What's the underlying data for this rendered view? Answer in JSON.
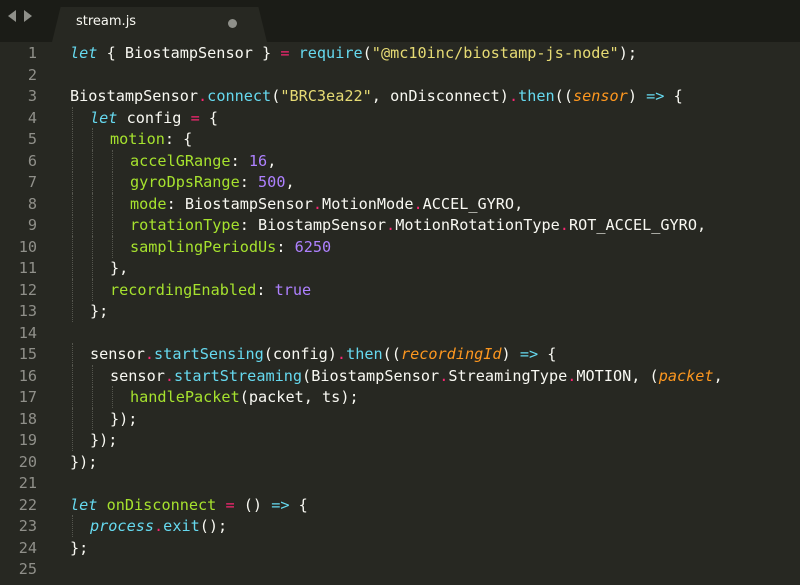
{
  "tab": {
    "label": "stream.js"
  },
  "lines": [
    {
      "n": "1",
      "indent": 0,
      "tokens": [
        [
          "kw",
          "let"
        ],
        [
          "plain",
          " { BiostampSensor } "
        ],
        [
          "op",
          "="
        ],
        [
          "plain",
          " "
        ],
        [
          "fn",
          "require"
        ],
        [
          "plain",
          "("
        ],
        [
          "str",
          "\"@mc10inc/biostamp-js-node\""
        ],
        [
          "plain",
          ");"
        ]
      ]
    },
    {
      "n": "2",
      "indent": 0,
      "tokens": []
    },
    {
      "n": "3",
      "indent": 0,
      "tokens": [
        [
          "plain",
          "BiostampSensor"
        ],
        [
          "op",
          "."
        ],
        [
          "fn",
          "connect"
        ],
        [
          "plain",
          "("
        ],
        [
          "str",
          "\"BRC3ea22\""
        ],
        [
          "plain",
          ", onDisconnect)"
        ],
        [
          "op",
          "."
        ],
        [
          "fn",
          "then"
        ],
        [
          "plain",
          "(("
        ],
        [
          "param",
          "sensor"
        ],
        [
          "plain",
          ") "
        ],
        [
          "fn",
          "=>"
        ],
        [
          "plain",
          " {"
        ]
      ]
    },
    {
      "n": "4",
      "indent": 1,
      "tokens": [
        [
          "kw",
          "let"
        ],
        [
          "plain",
          " config "
        ],
        [
          "op",
          "="
        ],
        [
          "plain",
          " {"
        ]
      ]
    },
    {
      "n": "5",
      "indent": 2,
      "tokens": [
        [
          "objkey",
          "motion"
        ],
        [
          "plain",
          ": {"
        ]
      ]
    },
    {
      "n": "6",
      "indent": 3,
      "tokens": [
        [
          "objkey",
          "accelGRange"
        ],
        [
          "plain",
          ": "
        ],
        [
          "num",
          "16"
        ],
        [
          "plain",
          ","
        ]
      ]
    },
    {
      "n": "7",
      "indent": 3,
      "tokens": [
        [
          "objkey",
          "gyroDpsRange"
        ],
        [
          "plain",
          ": "
        ],
        [
          "num",
          "500"
        ],
        [
          "plain",
          ","
        ]
      ]
    },
    {
      "n": "8",
      "indent": 3,
      "tokens": [
        [
          "objkey",
          "mode"
        ],
        [
          "plain",
          ": BiostampSensor"
        ],
        [
          "op",
          "."
        ],
        [
          "plain",
          "MotionMode"
        ],
        [
          "op",
          "."
        ],
        [
          "plain",
          "ACCEL_GYRO,"
        ]
      ]
    },
    {
      "n": "9",
      "indent": 3,
      "tokens": [
        [
          "objkey",
          "rotationType"
        ],
        [
          "plain",
          ": BiostampSensor"
        ],
        [
          "op",
          "."
        ],
        [
          "plain",
          "MotionRotationType"
        ],
        [
          "op",
          "."
        ],
        [
          "plain",
          "ROT_ACCEL_GYRO,"
        ]
      ]
    },
    {
      "n": "10",
      "indent": 3,
      "tokens": [
        [
          "objkey",
          "samplingPeriodUs"
        ],
        [
          "plain",
          ": "
        ],
        [
          "num",
          "6250"
        ]
      ]
    },
    {
      "n": "11",
      "indent": 2,
      "tokens": [
        [
          "plain",
          "},"
        ]
      ]
    },
    {
      "n": "12",
      "indent": 2,
      "tokens": [
        [
          "objkey",
          "recordingEnabled"
        ],
        [
          "plain",
          ": "
        ],
        [
          "bool",
          "true"
        ]
      ]
    },
    {
      "n": "13",
      "indent": 1,
      "tokens": [
        [
          "plain",
          "};"
        ]
      ]
    },
    {
      "n": "14",
      "indent": 0,
      "tokens": []
    },
    {
      "n": "15",
      "indent": 1,
      "tokens": [
        [
          "plain",
          "sensor"
        ],
        [
          "op",
          "."
        ],
        [
          "fn",
          "startSensing"
        ],
        [
          "plain",
          "(config)"
        ],
        [
          "op",
          "."
        ],
        [
          "fn",
          "then"
        ],
        [
          "plain",
          "(("
        ],
        [
          "param",
          "recordingId"
        ],
        [
          "plain",
          ") "
        ],
        [
          "fn",
          "=>"
        ],
        [
          "plain",
          " {"
        ]
      ]
    },
    {
      "n": "16",
      "indent": 2,
      "tokens": [
        [
          "plain",
          "sensor"
        ],
        [
          "op",
          "."
        ],
        [
          "fn",
          "startStreaming"
        ],
        [
          "plain",
          "(BiostampSensor"
        ],
        [
          "op",
          "."
        ],
        [
          "plain",
          "StreamingType"
        ],
        [
          "op",
          "."
        ],
        [
          "plain",
          "MOTION, ("
        ],
        [
          "param",
          "packet"
        ],
        [
          "plain",
          ","
        ]
      ]
    },
    {
      "n": "17",
      "indent": 3,
      "tokens": [
        [
          "prop",
          "handlePacket"
        ],
        [
          "plain",
          "(packet, ts);"
        ]
      ]
    },
    {
      "n": "18",
      "indent": 2,
      "tokens": [
        [
          "plain",
          "});"
        ]
      ]
    },
    {
      "n": "19",
      "indent": 1,
      "tokens": [
        [
          "plain",
          "});"
        ]
      ]
    },
    {
      "n": "20",
      "indent": 0,
      "tokens": [
        [
          "plain",
          "});"
        ]
      ]
    },
    {
      "n": "21",
      "indent": 0,
      "tokens": []
    },
    {
      "n": "22",
      "indent": 0,
      "tokens": [
        [
          "kw",
          "let"
        ],
        [
          "plain",
          " "
        ],
        [
          "prop",
          "onDisconnect"
        ],
        [
          "plain",
          " "
        ],
        [
          "op",
          "="
        ],
        [
          "plain",
          " () "
        ],
        [
          "fn",
          "=>"
        ],
        [
          "plain",
          " {"
        ]
      ]
    },
    {
      "n": "23",
      "indent": 1,
      "tokens": [
        [
          "glob",
          "process"
        ],
        [
          "op",
          "."
        ],
        [
          "fn",
          "exit"
        ],
        [
          "plain",
          "();"
        ]
      ]
    },
    {
      "n": "24",
      "indent": 0,
      "tokens": [
        [
          "plain",
          "};"
        ]
      ]
    },
    {
      "n": "25",
      "indent": 0,
      "tokens": []
    }
  ],
  "colors": {
    "background": "#272822",
    "tabbar": "#1b1c17",
    "keyword": "#66d9ef",
    "operator": "#f92672",
    "string": "#e6db74",
    "number": "#ae81ff",
    "parameter": "#fd971f",
    "property": "#a6e22e"
  },
  "icons": [
    "nav-back-icon",
    "nav-forward-icon",
    "unsaved-dot-icon"
  ]
}
